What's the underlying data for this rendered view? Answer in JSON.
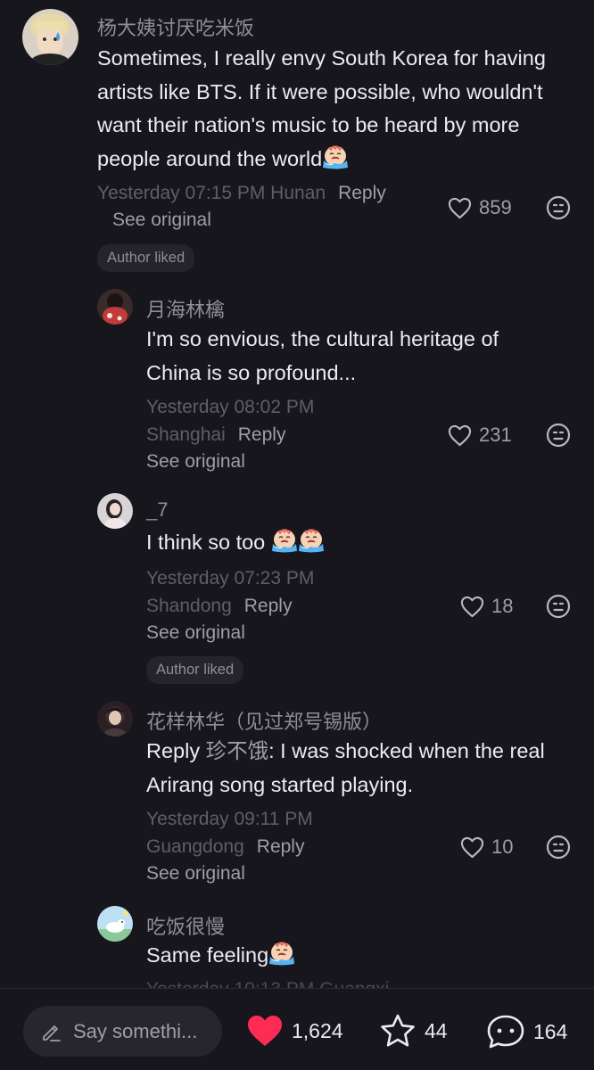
{
  "comments": [
    {
      "username": "杨大姨讨厌吃米饭",
      "text_lines": [
        "Sometimes, I really envy South Korea for having",
        "artists like BTS. If it were possible, who wouldn't",
        "want their nation's music to be heard by more",
        "people around the world"
      ],
      "timestamp": "Yesterday 07:15 PM Hunan",
      "reply_label": "Reply",
      "see_original": "See original",
      "likes": "859",
      "badge": "Author liked",
      "emoji": "crying-face-emoji"
    },
    {
      "username": "月海林檎",
      "text_lines": [
        "I'm so envious, the cultural heritage of",
        "China is so profound..."
      ],
      "timestamp": "Yesterday 08:02 PM",
      "location": "Shanghai",
      "reply_label": "Reply",
      "see_original": "See original",
      "likes": "231"
    },
    {
      "username": "_7",
      "text_lines": [
        "I think so too "
      ],
      "timestamp": "Yesterday 07:23 PM",
      "location": "Shandong",
      "reply_label": "Reply",
      "see_original": "See original",
      "likes": "18",
      "badge": "Author liked",
      "emoji": "crying-face-emoji"
    },
    {
      "username": "花样林华（见过郑号锡版）",
      "reply_prefix": "Reply",
      "reply_target": "珍不饿",
      "text_lines": [
        ": I was shocked when the real",
        "Arirang song started playing."
      ],
      "timestamp": "Yesterday 09:11 PM",
      "location": "Guangdong",
      "reply_label": "Reply",
      "see_original": "See original",
      "likes": "10"
    },
    {
      "username": "吃饭很慢",
      "text_lines": [
        "Same feeling"
      ],
      "timestamp_partial": "Yesterday 10:13 PM Guangxi",
      "emoji": "crying-face-emoji"
    }
  ],
  "bottom_bar": {
    "input_placeholder": "Say somethi...",
    "likes": "1,624",
    "favorites": "44",
    "comments": "164"
  },
  "colors": {
    "background": "#17161c",
    "text_primary": "#ecebf0",
    "text_secondary": "#9f9ea6",
    "text_muted": "#5f5e66",
    "like_red": "#fe2c55"
  }
}
